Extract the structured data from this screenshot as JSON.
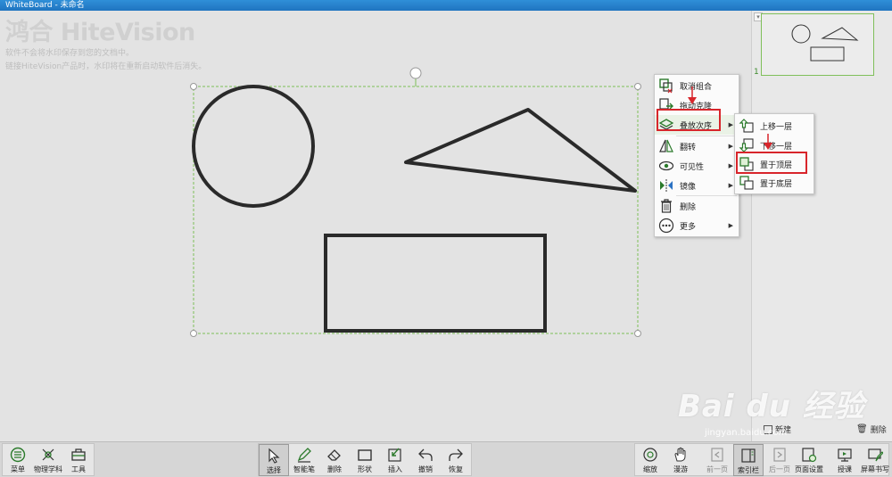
{
  "window": {
    "title": "WhiteBoard - 未命名"
  },
  "watermark": {
    "logo": "鸿合 HiteVision",
    "line1": "软件不会将水印保存到您的文档中。",
    "line2": "链接HiteVision产品时，水印将在重新启动软件后消失。"
  },
  "context_menu": {
    "items": [
      {
        "label": "取消组合",
        "icon": "ungroup-icon",
        "submenu": false
      },
      {
        "label": "拖动克隆",
        "icon": "drag-clone-icon",
        "submenu": false
      },
      {
        "label": "叠放次序",
        "icon": "layer-order-icon",
        "submenu": true
      },
      {
        "label": "翻转",
        "icon": "flip-icon",
        "submenu": true
      },
      {
        "label": "可见性",
        "icon": "eye-icon",
        "submenu": true
      },
      {
        "label": "镜像",
        "icon": "mirror-icon",
        "submenu": true
      },
      {
        "label": "删除",
        "icon": "trash-icon",
        "submenu": false
      },
      {
        "label": "更多",
        "icon": "more-icon",
        "submenu": true
      }
    ]
  },
  "order_submenu": {
    "items": [
      {
        "label": "上移一层",
        "icon": "move-up-icon"
      },
      {
        "label": "下移一层",
        "icon": "move-down-icon"
      },
      {
        "label": "置于顶层",
        "icon": "bring-to-front-icon"
      },
      {
        "label": "置于底层",
        "icon": "send-to-back-icon"
      }
    ]
  },
  "right_panel": {
    "page_number": "1",
    "new_label": "新建",
    "delete_label": "删除"
  },
  "toolbar": {
    "left": [
      {
        "label": "菜单",
        "icon": "menu-icon"
      },
      {
        "label": "物理学科",
        "icon": "physics-icon"
      },
      {
        "label": "工具",
        "icon": "toolbox-icon"
      }
    ],
    "center": [
      {
        "label": "选择",
        "icon": "cursor-icon",
        "selected": true
      },
      {
        "label": "智能笔",
        "icon": "smart-pen-icon"
      },
      {
        "label": "删除",
        "icon": "eraser-icon"
      },
      {
        "label": "形状",
        "icon": "shape-icon"
      },
      {
        "label": "插入",
        "icon": "insert-icon"
      },
      {
        "label": "撤销",
        "icon": "undo-icon"
      },
      {
        "label": "恢复",
        "icon": "redo-icon"
      }
    ],
    "right": [
      {
        "label": "缩放",
        "icon": "zoom-icon"
      },
      {
        "label": "漫游",
        "icon": "hand-icon"
      },
      {
        "label": "前一页",
        "icon": "prev-page-icon",
        "dim": true
      },
      {
        "label": "索引栏",
        "icon": "index-bar-icon",
        "selected": true
      },
      {
        "label": "后一页",
        "icon": "next-page-icon",
        "dim": true
      },
      {
        "label": "页面设置",
        "icon": "page-settings-icon"
      },
      {
        "label": "授课",
        "icon": "teach-icon"
      },
      {
        "label": "屏幕书写",
        "icon": "screen-write-icon"
      }
    ]
  },
  "colors": {
    "accent_green": "#5aa83a",
    "highlight_red": "#d8252b",
    "selection_dashed": "#7cbf57"
  },
  "site_watermark": {
    "brand": "Bai du 经验",
    "url": "jingyan.baidu.com"
  }
}
